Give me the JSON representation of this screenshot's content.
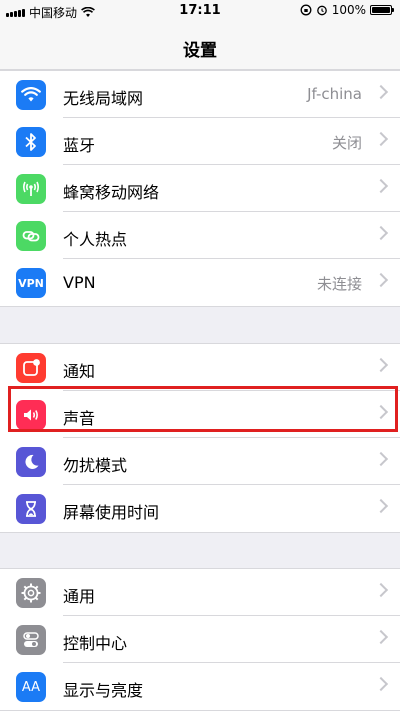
{
  "status_bar": {
    "carrier": "中国移动",
    "time": "17:11",
    "battery": "100%"
  },
  "nav": {
    "title": "设置"
  },
  "groups": [
    {
      "items": [
        {
          "label": "无线局域网",
          "value": "Jf-china",
          "icon": "wifi-icon",
          "color": "#1b7bf5"
        },
        {
          "label": "蓝牙",
          "value": "关闭",
          "icon": "bluetooth-icon",
          "color": "#1b7bf5"
        },
        {
          "label": "蜂窝移动网络",
          "value": "",
          "icon": "antenna-icon",
          "color": "#4cd964"
        },
        {
          "label": "个人热点",
          "value": "",
          "icon": "link-icon",
          "color": "#4cd964"
        },
        {
          "label": "VPN",
          "value": "未连接",
          "icon": "vpn-icon",
          "icon_text": "VPN",
          "color": "#1b7bf5"
        }
      ]
    },
    {
      "items": [
        {
          "label": "通知",
          "value": "",
          "icon": "notification-icon",
          "color": "#ff3b30"
        },
        {
          "label": "声音",
          "value": "",
          "icon": "speaker-icon",
          "color": "#ff2d55"
        },
        {
          "label": "勿扰模式",
          "value": "",
          "icon": "moon-icon",
          "color": "#5856d6"
        },
        {
          "label": "屏幕使用时间",
          "value": "",
          "icon": "hourglass-icon",
          "color": "#5856d6"
        }
      ]
    },
    {
      "items": [
        {
          "label": "通用",
          "value": "",
          "icon": "gear-icon",
          "color": "#8e8e93"
        },
        {
          "label": "控制中心",
          "value": "",
          "icon": "toggles-icon",
          "color": "#8e8e93"
        },
        {
          "label": "显示与亮度",
          "value": "",
          "icon": "text-size-icon",
          "icon_text": "AA",
          "color": "#1b7bf5"
        }
      ]
    }
  ]
}
